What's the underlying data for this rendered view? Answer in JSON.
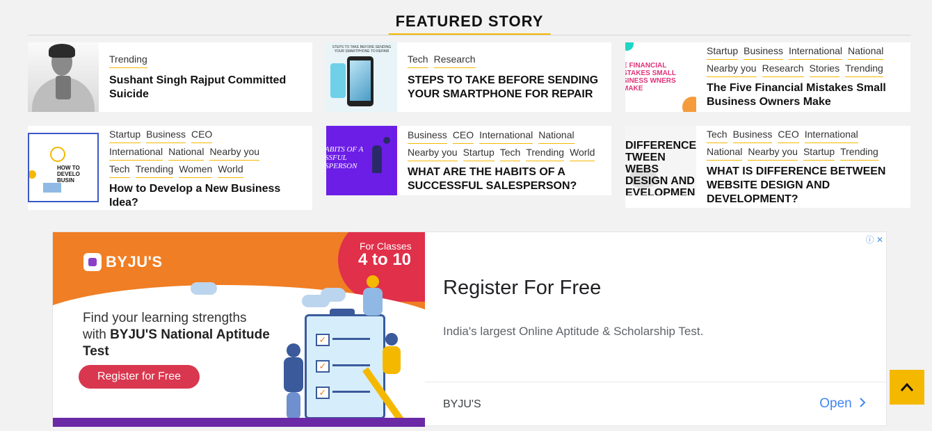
{
  "section": {
    "title": "FEATURED STORY"
  },
  "colors": {
    "accent": "#f5b800",
    "ad_orange": "#f07e24",
    "ad_red": "#e0304a",
    "link_blue": "#4285f4"
  },
  "cards": [
    {
      "tags": [
        "Trending"
      ],
      "title": "Sushant Singh Rajput Committed Suicide"
    },
    {
      "tags": [
        "Tech",
        "Research"
      ],
      "title": "STEPS TO TAKE BEFORE SENDING YOUR SMARTPHONE FOR REPAIR",
      "thumb_text": "STEPS TO TAKE BEFORE SENDING YOUR SMARTPHONE TO REPAIR"
    },
    {
      "tags": [
        "Startup",
        "Business",
        "International",
        "National",
        "Nearby you",
        "Research",
        "Stories",
        "Trending"
      ],
      "title": "The Five Financial Mistakes Small Business Owners Make",
      "thumb_text": "E FINANCIAL STAKES SMALL SINESS WNERS MAKE"
    },
    {
      "tags": [
        "Startup",
        "Business",
        "CEO",
        "International",
        "National",
        "Nearby you",
        "Tech",
        "Trending",
        "Women",
        "World"
      ],
      "title": "How to Develop a New Business Idea?",
      "thumb_text": "HOW TO DEVELO BUSIN"
    },
    {
      "tags": [
        "Business",
        "CEO",
        "International",
        "National",
        "Nearby you",
        "Startup",
        "Tech",
        "Trending",
        "World"
      ],
      "title": "WHAT ARE THE HABITS OF A SUCCESSFUL SALESPERSON?",
      "thumb_text": "ABITS OF A SSFUL SPERSON"
    },
    {
      "tags": [
        "Tech",
        "Business",
        "CEO",
        "International",
        "National",
        "Nearby you",
        "Startup",
        "Trending"
      ],
      "title": "WHAT IS DIFFERENCE BETWEEN WEBSITE DESIGN AND DEVELOPMENT?",
      "thumb_text": "DIFFERENCE TWEEN WEBS DESIGN AND EVELOPMEN"
    }
  ],
  "ad": {
    "brand_logo": "BYJU'S",
    "classes_line1": "For Classes",
    "classes_line2": "4 to 10",
    "copy_line1": "Find your learning strengths",
    "copy_prefix": "with ",
    "copy_bold": "BYJU'S National Aptitude Test",
    "cta": "Register for Free",
    "headline": "Register For Free",
    "description": "India's largest Online Aptitude & Scholarship Test.",
    "advertiser": "BYJU'S",
    "open_label": "Open",
    "badges": "ⓘ ✕"
  },
  "back_to_top_icon": "chevron-up-icon"
}
